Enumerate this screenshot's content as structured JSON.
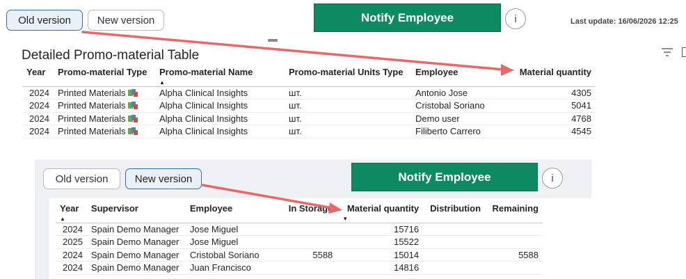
{
  "top": {
    "old_version": "Old version",
    "new_version": "New version",
    "notify": "Notify Employee",
    "info": "i",
    "last_update": "Last update: 16/06/2026 12:25",
    "table_title": "Detailed Promo-material Table",
    "columns": [
      "Year",
      "Promo-material Type",
      "Promo-material Name",
      "Promo-material Units Type",
      "Employee",
      "Material quantity"
    ],
    "sort_indicator": "▲",
    "rows": [
      [
        "2024",
        "Printed Materials",
        "Alpha Clinical Insights",
        "шт.",
        "Antonio Jose",
        "4305"
      ],
      [
        "2024",
        "Printed Materials",
        "Alpha Clinical Insights",
        "шт.",
        "Cristobal Soriano",
        "5041"
      ],
      [
        "2024",
        "Printed Materials",
        "Alpha Clinical Insights",
        "шт.",
        "Demo user",
        "4768"
      ],
      [
        "2024",
        "Printed Materials",
        "Alpha Clinical Insights",
        "шт.",
        "Filiberto Carrero",
        "4545"
      ]
    ]
  },
  "bottom": {
    "old_version": "Old version",
    "new_version": "New version",
    "notify": "Notify Employee",
    "info": "i",
    "columns": [
      "Year",
      "Supervisor",
      "Employee",
      "In Storage",
      "Material quantity",
      "Distribution",
      "Remaining"
    ],
    "sort_up": "▲",
    "sort_down": "▼",
    "rows": [
      [
        "2024",
        "Spain Demo Manager",
        "Jose Miguel",
        "",
        "15716",
        "",
        ""
      ],
      [
        "2025",
        "Spain Demo Manager",
        "Jose Miguel",
        "",
        "15522",
        "",
        ""
      ],
      [
        "2024",
        "Spain Demo Manager",
        "Cristobal Soriano",
        "5588",
        "15014",
        "",
        "5588"
      ],
      [
        "2024",
        "Spain Demo Manager",
        "Juan Francisco",
        "",
        "14816",
        "",
        ""
      ]
    ]
  },
  "colors": {
    "notify_bg": "#0e8a63",
    "annotation_arrow": "#e8686a",
    "active_border": "#3a6d9c"
  }
}
